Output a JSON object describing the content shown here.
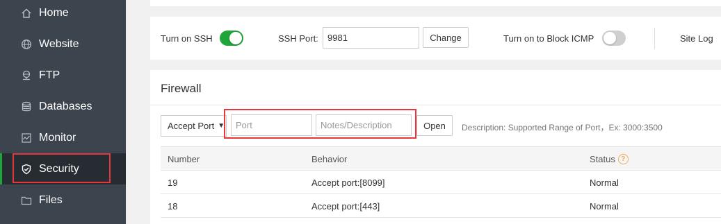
{
  "sidebar": {
    "items": [
      {
        "label": "Home",
        "icon": "home-icon"
      },
      {
        "label": "Website",
        "icon": "globe-icon"
      },
      {
        "label": "FTP",
        "icon": "ftp-icon"
      },
      {
        "label": "Databases",
        "icon": "database-icon"
      },
      {
        "label": "Monitor",
        "icon": "monitor-icon"
      },
      {
        "label": "Security",
        "icon": "shield-icon",
        "active": true
      },
      {
        "label": "Files",
        "icon": "folder-icon"
      }
    ]
  },
  "ssh": {
    "turn_on_ssh_label": "Turn on SSH",
    "ssh_enabled": true,
    "port_label": "SSH Port:",
    "port_value": "9981",
    "change_button": "Change",
    "block_icmp_label": "Turn on to Block ICMP",
    "block_icmp_enabled": false,
    "site_log_label": "Site Log"
  },
  "firewall": {
    "title": "Firewall",
    "mode_select": "Accept Port",
    "port_placeholder": "Port",
    "notes_placeholder": "Notes/Description",
    "open_button": "Open",
    "description": "Description: Supported Range of Port，Ex: 3000:3500",
    "columns": {
      "number": "Number",
      "behavior": "Behavior",
      "status": "Status"
    },
    "rows": [
      {
        "number": "19",
        "behavior": "Accept port:[8099]",
        "status": "Normal"
      },
      {
        "number": "18",
        "behavior": "Accept port:[443]",
        "status": "Normal"
      }
    ]
  },
  "colors": {
    "accent": "#20a53a",
    "highlight": "#e5373b",
    "sidebar_bg": "#3c444d",
    "sidebar_active_bg": "#262c31",
    "help_icon": "#f0ad4e"
  }
}
